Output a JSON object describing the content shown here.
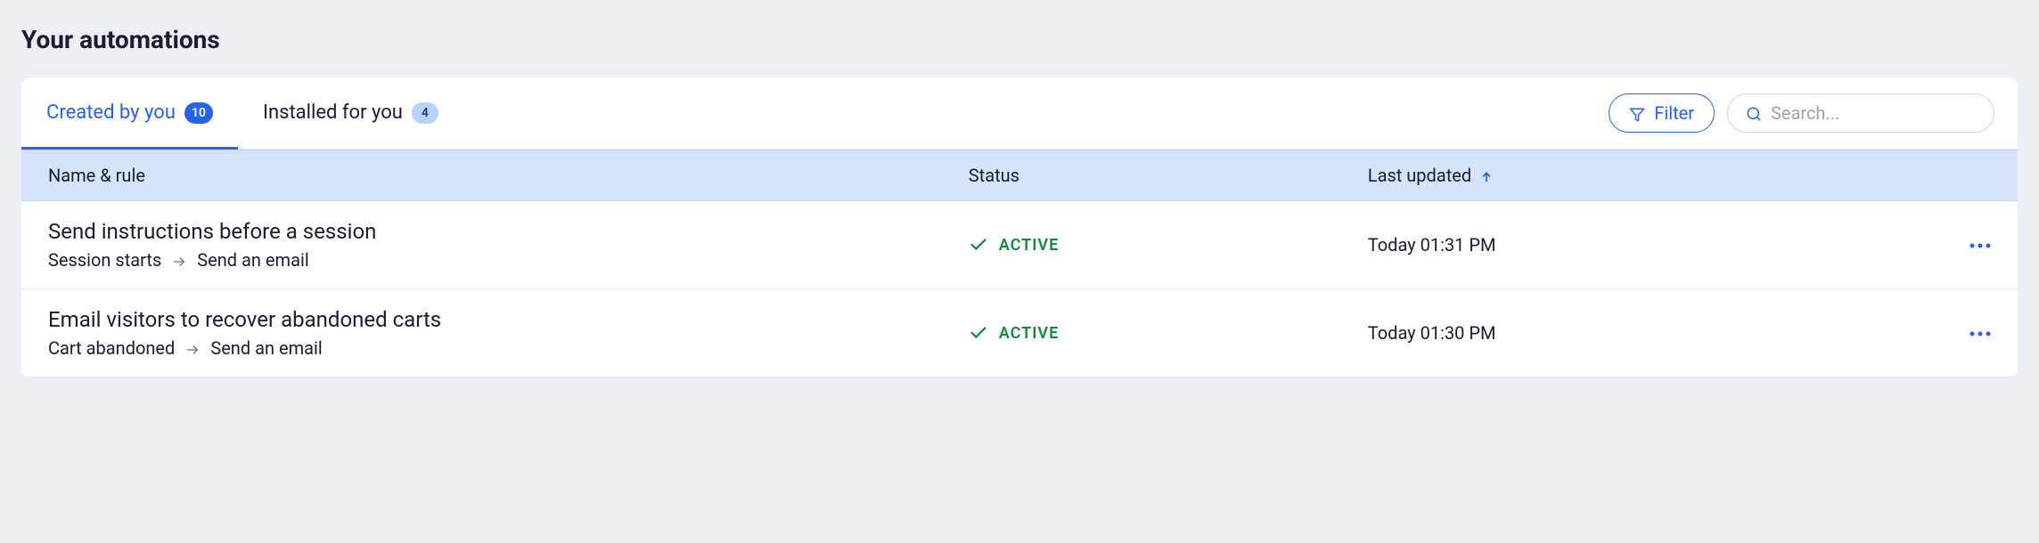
{
  "page": {
    "title": "Your automations"
  },
  "tabs": {
    "created": {
      "label": "Created by you",
      "count": "10"
    },
    "installed": {
      "label": "Installed for you",
      "count": "4"
    }
  },
  "controls": {
    "filter_label": "Filter",
    "search_placeholder": "Search..."
  },
  "table": {
    "headers": {
      "name": "Name & rule",
      "status": "Status",
      "updated": "Last updated"
    }
  },
  "rows": [
    {
      "title": "Send instructions before a session",
      "trigger": "Session starts",
      "action": "Send an email",
      "status": "ACTIVE",
      "updated": "Today 01:31 PM"
    },
    {
      "title": "Email visitors to recover abandoned carts",
      "trigger": "Cart abandoned",
      "action": "Send an email",
      "status": "ACTIVE",
      "updated": "Today 01:30 PM"
    }
  ]
}
